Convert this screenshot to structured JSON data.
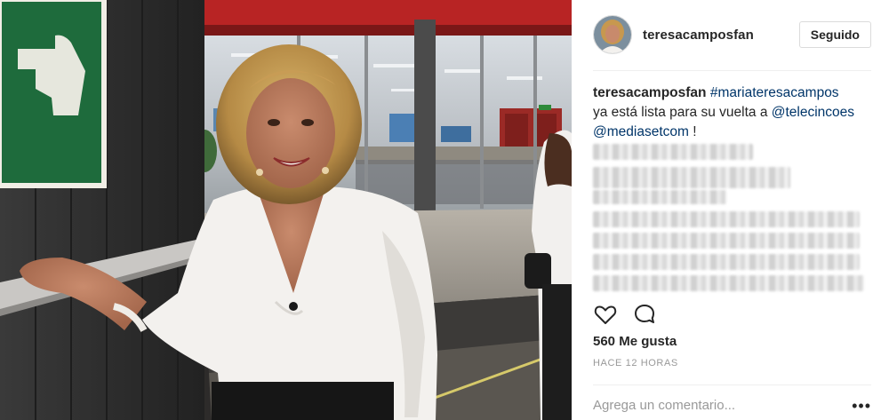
{
  "post": {
    "username": "teresacamposfan",
    "follow_label": "Seguido",
    "caption": {
      "username": "teresacamposfan",
      "hashtag": "#mariateresacampos",
      "text_line2_prefix": "ya está lista para su vuelta a ",
      "mention1": "@telecincoes",
      "mention2": "@mediasetcom",
      "suffix": " !"
    },
    "likes_label": "560 Me gusta",
    "timestamp": "HACE 12 HORAS",
    "comment_placeholder": "Agrega un comentario...",
    "more_label": "•••"
  },
  "icons": {
    "like": "heart-icon",
    "comment": "comment-bubble-icon",
    "more": "more-options-icon",
    "avatar": "avatar",
    "exit_sign": "exit-sign-icon"
  },
  "colors": {
    "link": "#003569",
    "text": "#262626",
    "muted": "#999999",
    "border": "#dbdbdb",
    "sign_green": "#1e6b3c"
  }
}
